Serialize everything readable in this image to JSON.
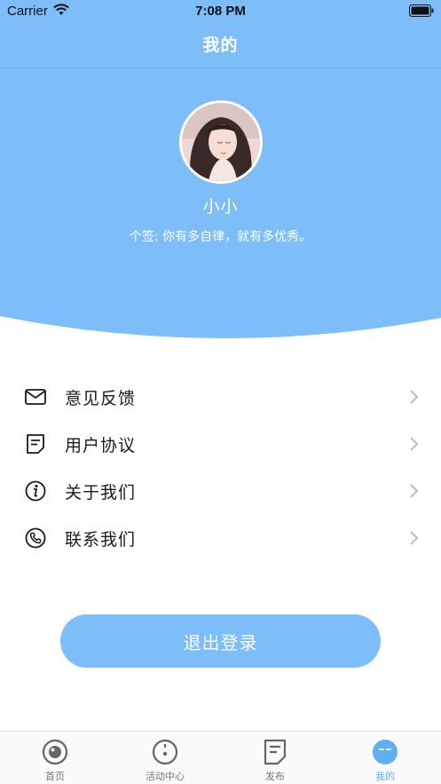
{
  "status_bar": {
    "carrier": "Carrier",
    "time": "7:08 PM"
  },
  "nav": {
    "title": "我的"
  },
  "profile": {
    "username": "小小",
    "signature": "个签: 你有多自律，就有多优秀。"
  },
  "menu": {
    "items": [
      {
        "label": "意见反馈",
        "icon": "mail-icon"
      },
      {
        "label": "用户协议",
        "icon": "document-icon"
      },
      {
        "label": "关于我们",
        "icon": "info-icon"
      },
      {
        "label": "联系我们",
        "icon": "phone-icon"
      }
    ]
  },
  "logout": {
    "label": "退出登录"
  },
  "tabbar": {
    "tabs": [
      {
        "label": "首页",
        "icon": "home-icon",
        "active": false
      },
      {
        "label": "活动中心",
        "icon": "activity-icon",
        "active": false
      },
      {
        "label": "发布",
        "icon": "publish-icon",
        "active": false
      },
      {
        "label": "我的",
        "icon": "profile-icon",
        "active": true
      }
    ]
  },
  "colors": {
    "primary": "#7dbdf9",
    "active_tab": "#5fb0f2",
    "text": "#1a1a1a",
    "inactive_tab": "#777777"
  }
}
